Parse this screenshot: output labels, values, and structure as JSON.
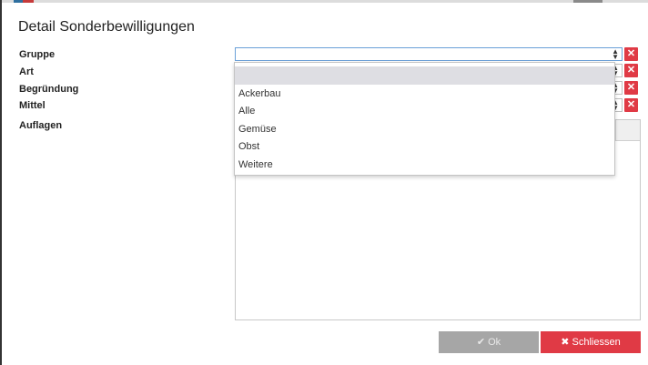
{
  "dialog": {
    "title": "Detail Sonderbewilligungen"
  },
  "fields": {
    "gruppe": "Gruppe",
    "art": "Art",
    "begruendung": "Begründung",
    "mittel": "Mittel",
    "auflagen": "Auflagen"
  },
  "dropdown": {
    "options": [
      "Ackerbau",
      "Alle",
      "Gemüse",
      "Obst",
      "Weitere"
    ]
  },
  "buttons": {
    "ok": "Ok",
    "close": "Schliessen",
    "clear_glyph": "✕"
  },
  "icons": {
    "ok": "check-icon",
    "close": "x-icon",
    "select_arrow": "sort-arrows-icon"
  }
}
